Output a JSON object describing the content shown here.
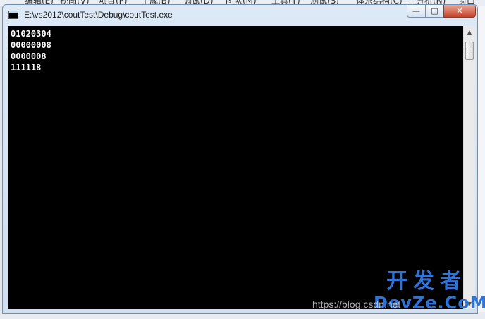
{
  "background_ide": {
    "menu_items": [
      "编辑(E)",
      "视图(V)",
      "项目(P)",
      "生成(B)",
      "调试(D)",
      "团队(M)",
      "工具(T)",
      "测试(S)",
      "体系结构(C)",
      "分析(N)",
      "窗口(W)"
    ]
  },
  "window": {
    "title": "E:\\vs2012\\coutTest\\Debug\\coutTest.exe",
    "buttons": {
      "minimize": "—",
      "maximize": "□",
      "close": "✕"
    }
  },
  "console": {
    "lines": [
      "01020304",
      "00000008",
      "0000008",
      "111118"
    ]
  },
  "scrollbar": {
    "up_arrow": "▲",
    "down_arrow": "▼"
  },
  "watermark": {
    "brand_cn": "开发者",
    "brand_en": "DevZe.CoM",
    "url": "https://blog.csdn.net"
  },
  "colors": {
    "console_bg": "#000000",
    "console_fg": "#ffffff",
    "watermark": "#2f73d9",
    "close_button": "#c8422a"
  }
}
